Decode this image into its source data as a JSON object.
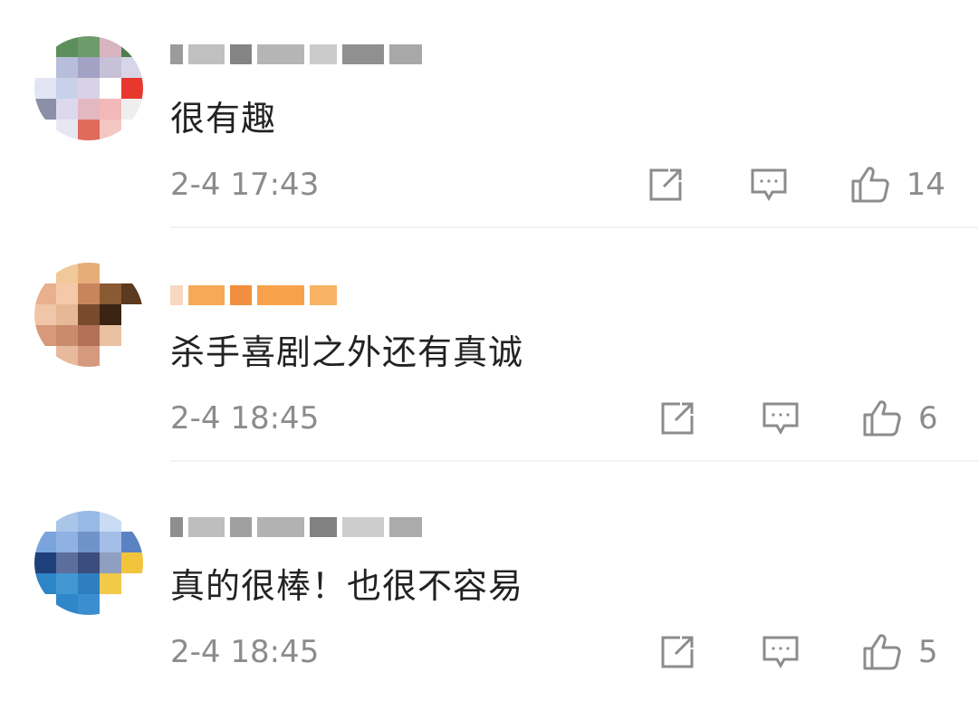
{
  "comments": [
    {
      "text": "很有趣",
      "time": "2-4  17:43",
      "likes": "14",
      "avatar_colors": [
        "#ffffff",
        "#5c8f5b",
        "#6e9b6a",
        "#d7b4c0",
        "#4e7c4e",
        "#ffffff",
        "#b7bedb",
        "#a4a2c4",
        "#c7c1d7",
        "#d7d5e8",
        "#e1e5f4",
        "#c9d0ea",
        "#d9d2e6",
        "#ffffff",
        "#e8372d",
        "#8b8fa8",
        "#dcd9ee",
        "#e4b8c0",
        "#f3b8b8",
        "#eeeeee",
        "#ffffff",
        "#e7e7f2",
        "#e06b5c",
        "#f4c7c2",
        "#ffffff"
      ],
      "name_blocks": [
        "#8a8a8a",
        "#b5b5b5",
        "#6f6f6f",
        "#a8a8a8",
        "#c2c2c2",
        "#7d7d7d",
        "#999999"
      ]
    },
    {
      "text": "杀手喜剧之外还有真诚",
      "time": "2-4  18:45",
      "likes": "6",
      "avatar_colors": [
        "#ffffff",
        "#f0c89a",
        "#e6ad7a",
        "#ffffff",
        "#ffffff",
        "#e8b08d",
        "#f4c9a9",
        "#c8855c",
        "#8a5a33",
        "#5b3a1f",
        "#f1c6a8",
        "#e7b896",
        "#7a4a2c",
        "#3c2414",
        "#ffffff",
        "#d6997a",
        "#c98b6c",
        "#b37258",
        "#e9c1a2",
        "#ffffff",
        "#ffffff",
        "#e7b99d",
        "#d59a7e",
        "#ffffff",
        "#ffffff"
      ],
      "name_blocks": [
        "#f7d0b5",
        "#f59a3a",
        "#f07b1c",
        "#f6922b",
        "#f8a64a"
      ]
    },
    {
      "text": "真的很棒！也很不容易",
      "time": "2-4  18:45",
      "likes": "5",
      "avatar_colors": [
        "#ffffff",
        "#a9c5e8",
        "#97b9e6",
        "#c9dcf3",
        "#ffffff",
        "#7aa4dc",
        "#8fb1e4",
        "#6f93c9",
        "#a3bfe7",
        "#5b82c2",
        "#1f3f7a",
        "#5c6f9c",
        "#3a4d7c",
        "#8e9fbf",
        "#f2c43b",
        "#2d84c6",
        "#4297d3",
        "#2e7fc0",
        "#f3c94a",
        "#ffffff",
        "#ffffff",
        "#2f86c9",
        "#3b8fd0",
        "#ffffff",
        "#ffffff"
      ],
      "name_blocks": [
        "#7a7a7a",
        "#b3b3b3",
        "#8f8f8f",
        "#a5a5a5",
        "#6b6b6b",
        "#c4c4c4",
        "#9c9c9c"
      ]
    }
  ]
}
